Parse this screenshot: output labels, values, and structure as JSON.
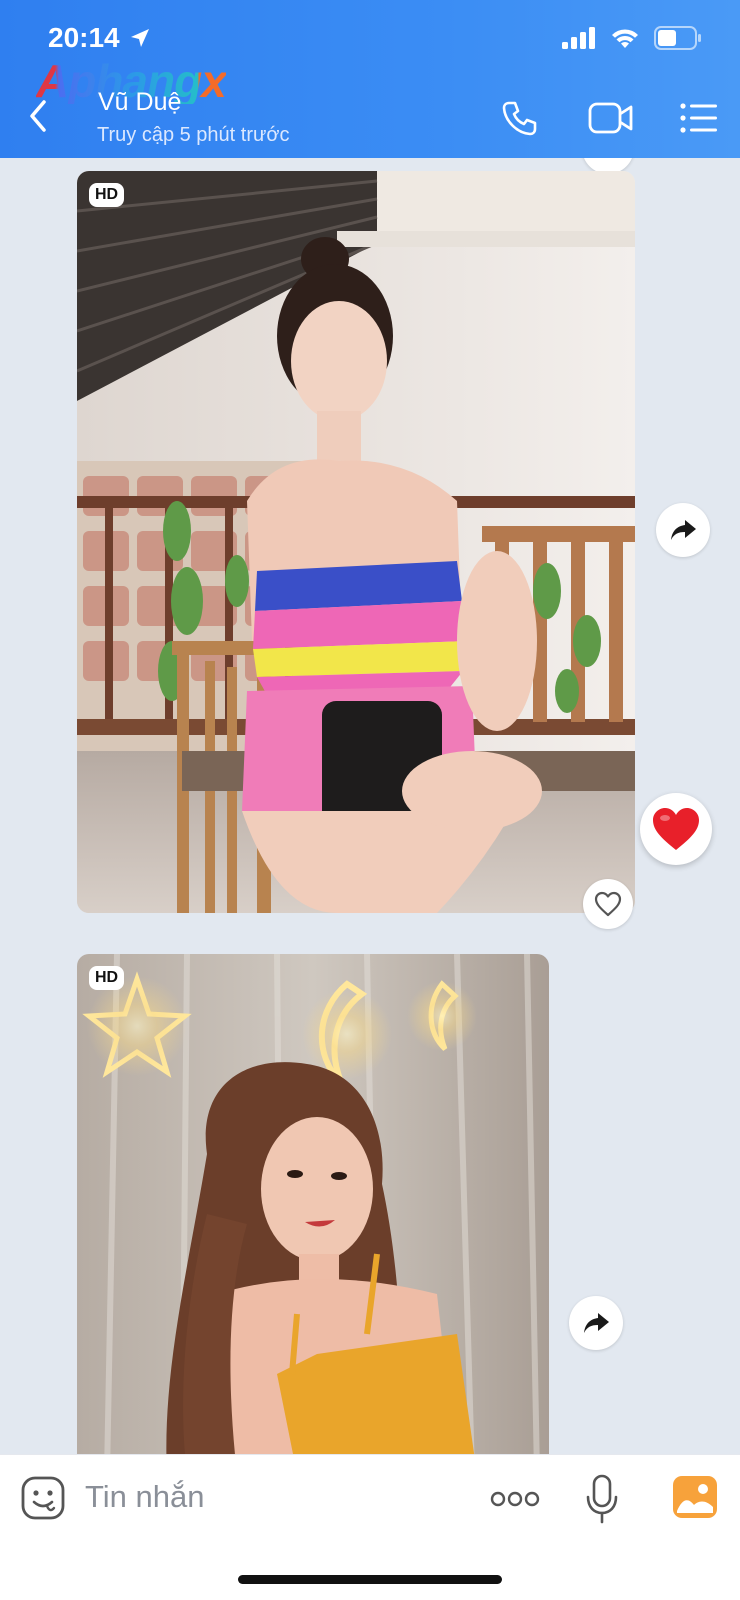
{
  "status_bar": {
    "time": "20:14"
  },
  "watermark": "Aphangx",
  "header": {
    "contact_name": "Vũ Duệ",
    "last_seen": "Truy cập 5 phút trước"
  },
  "messages": [
    {
      "type": "photo",
      "badge": "HD",
      "reaction": "heart-outline",
      "liked": true
    },
    {
      "type": "photo",
      "badge": "HD"
    }
  ],
  "input_bar": {
    "placeholder": "Tin nhắn"
  },
  "colors": {
    "header_blue": "#3b8df4",
    "chat_bg": "#e2e8f0",
    "heart_red": "#e8202a",
    "image_button_orange": "#f7a23b"
  }
}
